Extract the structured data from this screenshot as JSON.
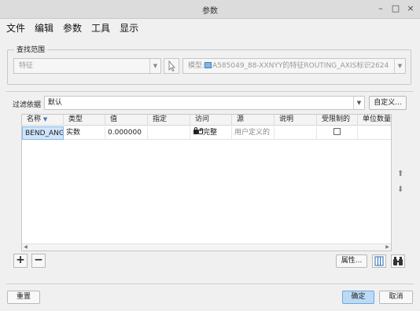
{
  "window": {
    "title": "参数",
    "controls": [
      "–",
      "□",
      "×"
    ]
  },
  "menu": [
    "文件",
    "编辑",
    "参数",
    "工具",
    "显示"
  ],
  "lookup": {
    "group_label": "查找范围",
    "type_value": "特征",
    "model_prefix": "模型:",
    "model_value": "A585049_88-XXNYY的特征ROUTING_AXIS标识2624"
  },
  "filter": {
    "label": "过滤依据",
    "value": "默认",
    "customize_button": "自定义..."
  },
  "table": {
    "columns": [
      "名称",
      "类型",
      "值",
      "指定",
      "访问",
      "源",
      "说明",
      "受限制的",
      "单位数量"
    ],
    "rows": [
      {
        "name": "BEND_ANGLE",
        "type": "实数",
        "value": "0.000000",
        "designate": "",
        "access": "完整",
        "source": "用户定义的",
        "description": "",
        "restricted": false,
        "units": ""
      }
    ]
  },
  "table_tools": {
    "add": "+",
    "remove": "−",
    "properties_button": "属性..."
  },
  "footer": {
    "reset_button": "重置",
    "ok_button": "确定",
    "cancel_button": "取消"
  },
  "colors": {
    "accent": "#bcdaf6",
    "selection": "#cfe5fb"
  }
}
